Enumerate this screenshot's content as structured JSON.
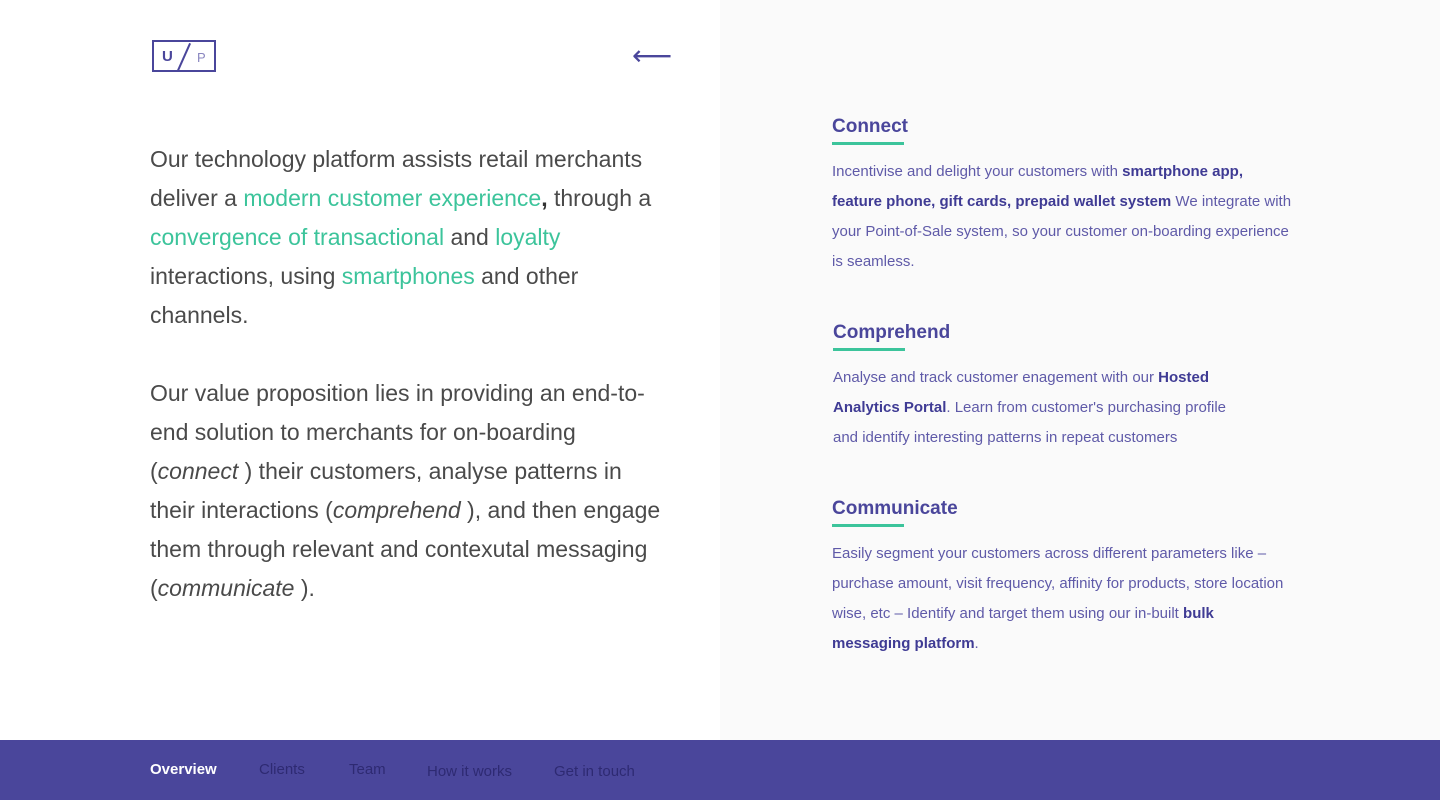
{
  "logo": {
    "letter_left": "U",
    "letter_right": "P"
  },
  "back_icon": "arrow-left-icon",
  "intro": {
    "p1": "Our technology platform assists retail merchants deliver a ",
    "hl1": "modern customer experience",
    "p2": ",",
    "p3": " through a ",
    "hl2": "convergence of transactional",
    "p4": " and ",
    "hl3": "loyalty",
    "p5": " interactions, using ",
    "hl4": "smartphones",
    "p6": " and other channels."
  },
  "value": {
    "p1": "Our value proposition lies in providing an end-to-end solution to merchants for on-boarding (",
    "em1": "connect",
    "p2": " ) their customers, analyse patterns in their interactions (",
    "em2": "comprehend",
    "p3": " ), and then engage them through relevant and contexutal messaging (",
    "em3": "communicate",
    "p4": " )."
  },
  "sections": [
    {
      "title": "Connect",
      "text1": "Incentivise and delight your customers with ",
      "bold1": "smartphone app, feature phone, gift cards, prepaid wallet system",
      "text2": "  We integrate with your Point-of-Sale system, so your customer on-boarding experience is seamless."
    },
    {
      "title": "Comprehend",
      "text1": "Analyse and track customer enagement with our ",
      "bold1": "Hosted Analytics Portal",
      "text2": ". Learn from customer's purchasing profile and identify interesting patterns in repeat customers"
    },
    {
      "title": "Communicate",
      "text1": "Easily segment your customers across different parameters like – purchase amount, visit frequency, affinity for products, store location wise, etc – Identify and target them using our in-built ",
      "bold1": "bulk messaging platform",
      "text2": "."
    }
  ],
  "nav": {
    "items": [
      "Overview",
      "Clients",
      "Team",
      "How it works",
      "Get in touch"
    ],
    "active": "Overview"
  },
  "colors": {
    "accent": "#3cc49b",
    "brand": "#4a469b",
    "panel": "#fafafa"
  }
}
